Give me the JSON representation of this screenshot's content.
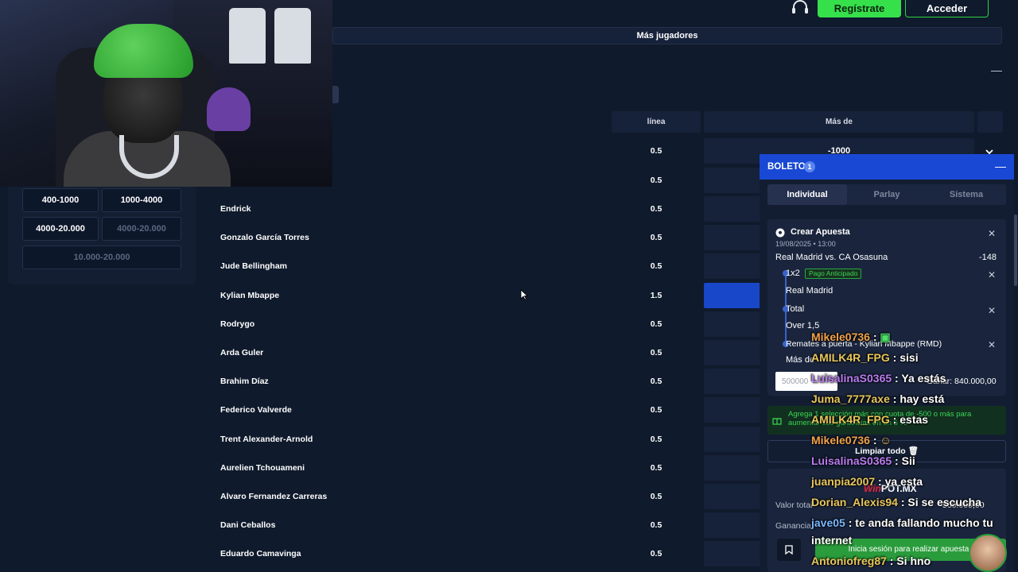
{
  "header": {
    "register_label": "Regístrate",
    "login_label": "Acceder",
    "more_players_label": "Más jugadores"
  },
  "filters": [
    {
      "label": "400-1000",
      "enabled": true
    },
    {
      "label": "1000-4000",
      "enabled": true
    },
    {
      "label": "4000-20.000",
      "enabled": true
    },
    {
      "label": "4000-20.000",
      "enabled": false
    },
    {
      "label": "10.000-20.000",
      "enabled": false
    }
  ],
  "table": {
    "col_line": "línea",
    "col_over": "Más de",
    "first_row": {
      "line": "0.5",
      "odd": "-1000"
    },
    "rows": [
      {
        "name": "",
        "line": "0.5"
      },
      {
        "name": "Endrick",
        "line": "0.5"
      },
      {
        "name": "Gonzalo García Torres",
        "line": "0.5"
      },
      {
        "name": "Jude Bellingham",
        "line": "0.5"
      },
      {
        "name": "Kylian Mbappe",
        "line": "1.5"
      },
      {
        "name": "Rodrygo",
        "line": "0.5"
      },
      {
        "name": "Arda Guler",
        "line": "0.5"
      },
      {
        "name": "Brahim Díaz",
        "line": "0.5"
      },
      {
        "name": "Federico Valverde",
        "line": "0.5"
      },
      {
        "name": "Trent Alexander-Arnold",
        "line": "0.5"
      },
      {
        "name": "Aurelien Tchouameni",
        "line": "0.5"
      },
      {
        "name": "Alvaro Fernandez Carreras",
        "line": "0.5"
      },
      {
        "name": "Dani Ceballos",
        "line": "0.5"
      },
      {
        "name": "Eduardo Camavinga",
        "line": "0.5"
      }
    ]
  },
  "betslip": {
    "title": "BOLETO",
    "count": "1",
    "tabs": [
      "Individual",
      "Parlay",
      "Sistema"
    ],
    "bet_title": "Crear Apuesta",
    "date": "19/08/2025 • 13:00",
    "match": "Real Madrid vs. CA Osasuna",
    "odds": "-148",
    "sel1_market": "1x2",
    "sel1_tag": "Pago Anticipado",
    "sel1_pick": "Real Madrid",
    "sel2_market": "Total",
    "sel2_pick": "Over 1,5",
    "sel3_market": "Remates a puerta - Kylian Mbappe (RMD)",
    "sel3_pick": "Más de",
    "stake": "500000",
    "win_label": "Ganar: 840.000,00",
    "promo": "Agrega 1 selección más con cuota de -500 o más para aumentar sus ganancias en un 5 %",
    "clear_all": "Limpiar todo",
    "total_label": "Valor total",
    "total_value": "500.000,00",
    "gain_label": "Ganancia",
    "login_prompt": "Inicia sesión para realizar apuestas"
  },
  "brand": {
    "win": "Win",
    "pot": "POT.MX"
  },
  "chat": [
    {
      "user": "Mikele0736",
      "text": "",
      "color": "u1"
    },
    {
      "user": "AMILK4R_FPG",
      "text": "sisi",
      "color": "u3"
    },
    {
      "user": "LuisalinaS0365",
      "text": "Ya estás",
      "color": "u2"
    },
    {
      "user": "Juma_7777axe",
      "text": "hay está",
      "color": "u3"
    },
    {
      "user": "AMILK4R_FPG",
      "text": "estas",
      "color": "u3"
    },
    {
      "user": "Mikele0736",
      "text": "",
      "color": "u1"
    },
    {
      "user": "LuisalinaS0365",
      "text": "Sii",
      "color": "u2"
    },
    {
      "user": "juanpia2007",
      "text": "ya esta",
      "color": "u3"
    },
    {
      "user": "Dorian_Alexis94",
      "text": "Si se escucha",
      "color": "u3"
    },
    {
      "user": "jave05",
      "text": "te anda fallando mucho tu",
      "color": "u4"
    },
    {
      "user": "",
      "text": "internet",
      "color": "u4"
    },
    {
      "user": "Antoniofreg87",
      "text": "Si hno",
      "color": "u3"
    }
  ],
  "colors": {
    "accent": "#1948d4",
    "green": "#35e04a",
    "bg": "#0f1a2c"
  }
}
